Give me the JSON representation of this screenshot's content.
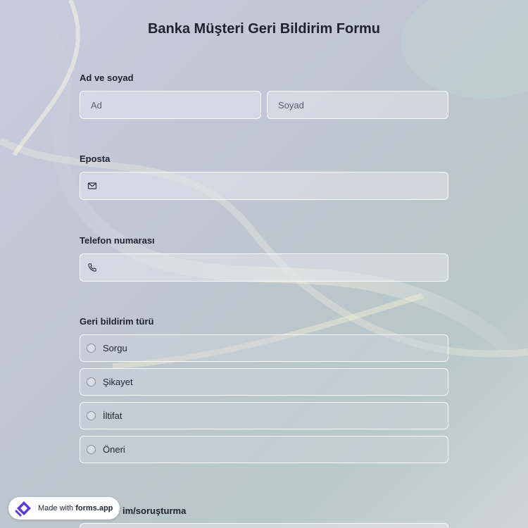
{
  "form": {
    "title": "Banka Müşteri Geri Bildirim Formu"
  },
  "name_section": {
    "label": "Ad ve soyad",
    "first_placeholder": "Ad",
    "last_placeholder": "Soyad"
  },
  "email_section": {
    "label": "Eposta",
    "value": "",
    "icon": "mail-icon"
  },
  "phone_section": {
    "label": "Telefon numarası",
    "value": "",
    "icon": "phone-icon"
  },
  "feedback_type": {
    "label": "Geri bildirim türü",
    "options": [
      "Sorgu",
      "Şikayet",
      "İltifat",
      "Öneri"
    ]
  },
  "next_section": {
    "label_partial": "im/soruşturma"
  },
  "badge": {
    "prefix": "Made with ",
    "brand": "forms.app"
  }
}
